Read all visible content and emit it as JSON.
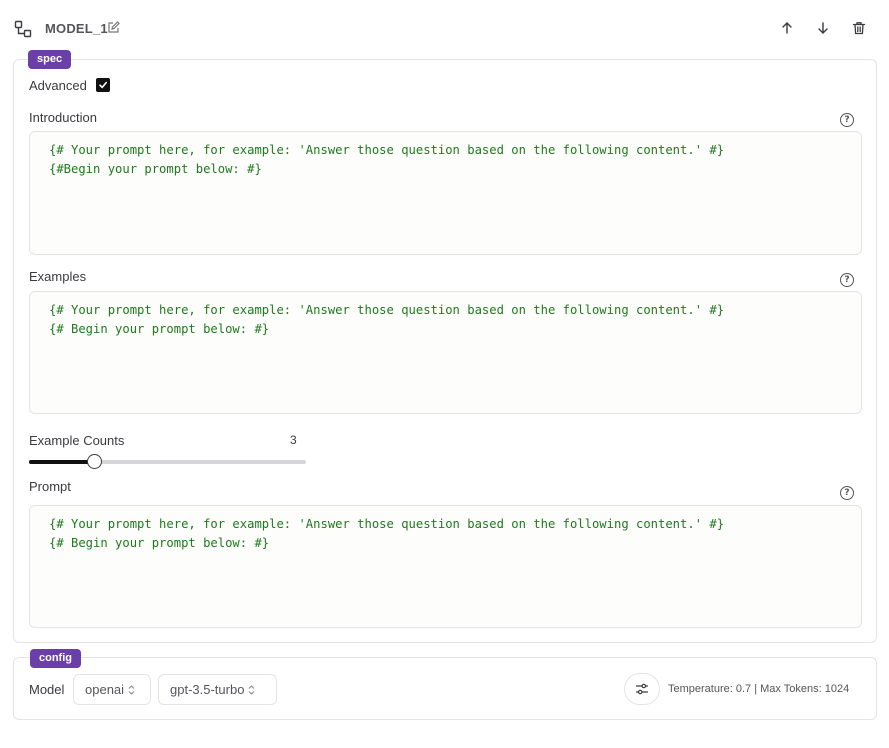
{
  "node": {
    "title": "MODEL_1",
    "icons": {
      "node": "workflow-node-icon",
      "edit": "edit-icon",
      "up": "arrow-up-icon",
      "down": "arrow-down-icon",
      "delete": "trash-icon"
    }
  },
  "spec": {
    "badge": "spec",
    "advanced_label": "Advanced",
    "advanced_checked": true,
    "introduction": {
      "label": "Introduction",
      "help": "?",
      "content": "{# Your prompt here, for example: 'Answer those question based on the following content.' #}\n{#Begin your prompt below: #}"
    },
    "examples": {
      "label": "Examples",
      "help": "?",
      "content": "{# Your prompt here, for example: 'Answer those question based on the following content.' #}\n{# Begin your prompt below: #}"
    },
    "example_counts": {
      "label": "Example Counts",
      "value": "3",
      "slider_fraction": 0.235
    },
    "prompt": {
      "label": "Prompt",
      "help": "?",
      "content": "{# Your prompt here, for example: 'Answer those question based on the following content.' #}\n{# Begin your prompt below: #}"
    }
  },
  "config": {
    "badge": "config",
    "model_label": "Model",
    "provider": "openai",
    "model": "gpt-3.5-turbo",
    "settings_icon": "sliders-icon",
    "info": "Temperature: 0.7 | Max Tokens: 1024"
  },
  "colors": {
    "badge": "#6b3fa8",
    "code": "#1e7a1e"
  }
}
